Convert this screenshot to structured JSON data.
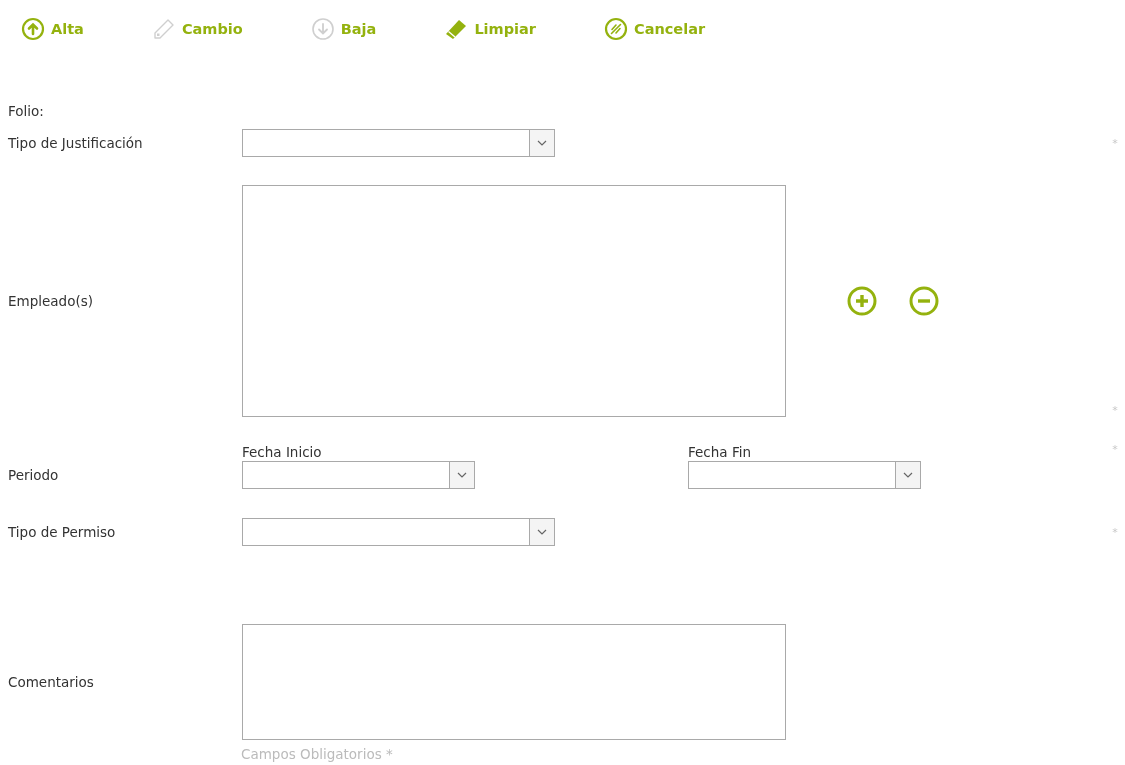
{
  "toolbar": [
    {
      "label": "Alta",
      "kind": "add",
      "disabled": false
    },
    {
      "label": "Cambio",
      "kind": "edit",
      "disabled": true
    },
    {
      "label": "Baja",
      "kind": "remove",
      "disabled": true
    },
    {
      "label": "Limpiar",
      "kind": "clear",
      "disabled": false
    },
    {
      "label": "Cancelar",
      "kind": "cancel",
      "disabled": false
    }
  ],
  "fields": [
    {
      "kind": "text",
      "label": "Folio:"
    },
    {
      "kind": "select",
      "label": "Tipo de Justificación",
      "required_mark": "*"
    },
    {
      "kind": "list",
      "label": "Empleado(s)",
      "required_mark": "*"
    },
    {
      "kind": "range",
      "label": "Periodo",
      "start_label": "Fecha Inicio",
      "end_label": "Fecha Fin",
      "required_mark": "*"
    },
    {
      "kind": "select",
      "label": "Tipo de Permiso",
      "required_mark": "*"
    },
    {
      "kind": "textarea",
      "label": "Comentarios"
    }
  ],
  "footer": "Campos Obligatorios *"
}
